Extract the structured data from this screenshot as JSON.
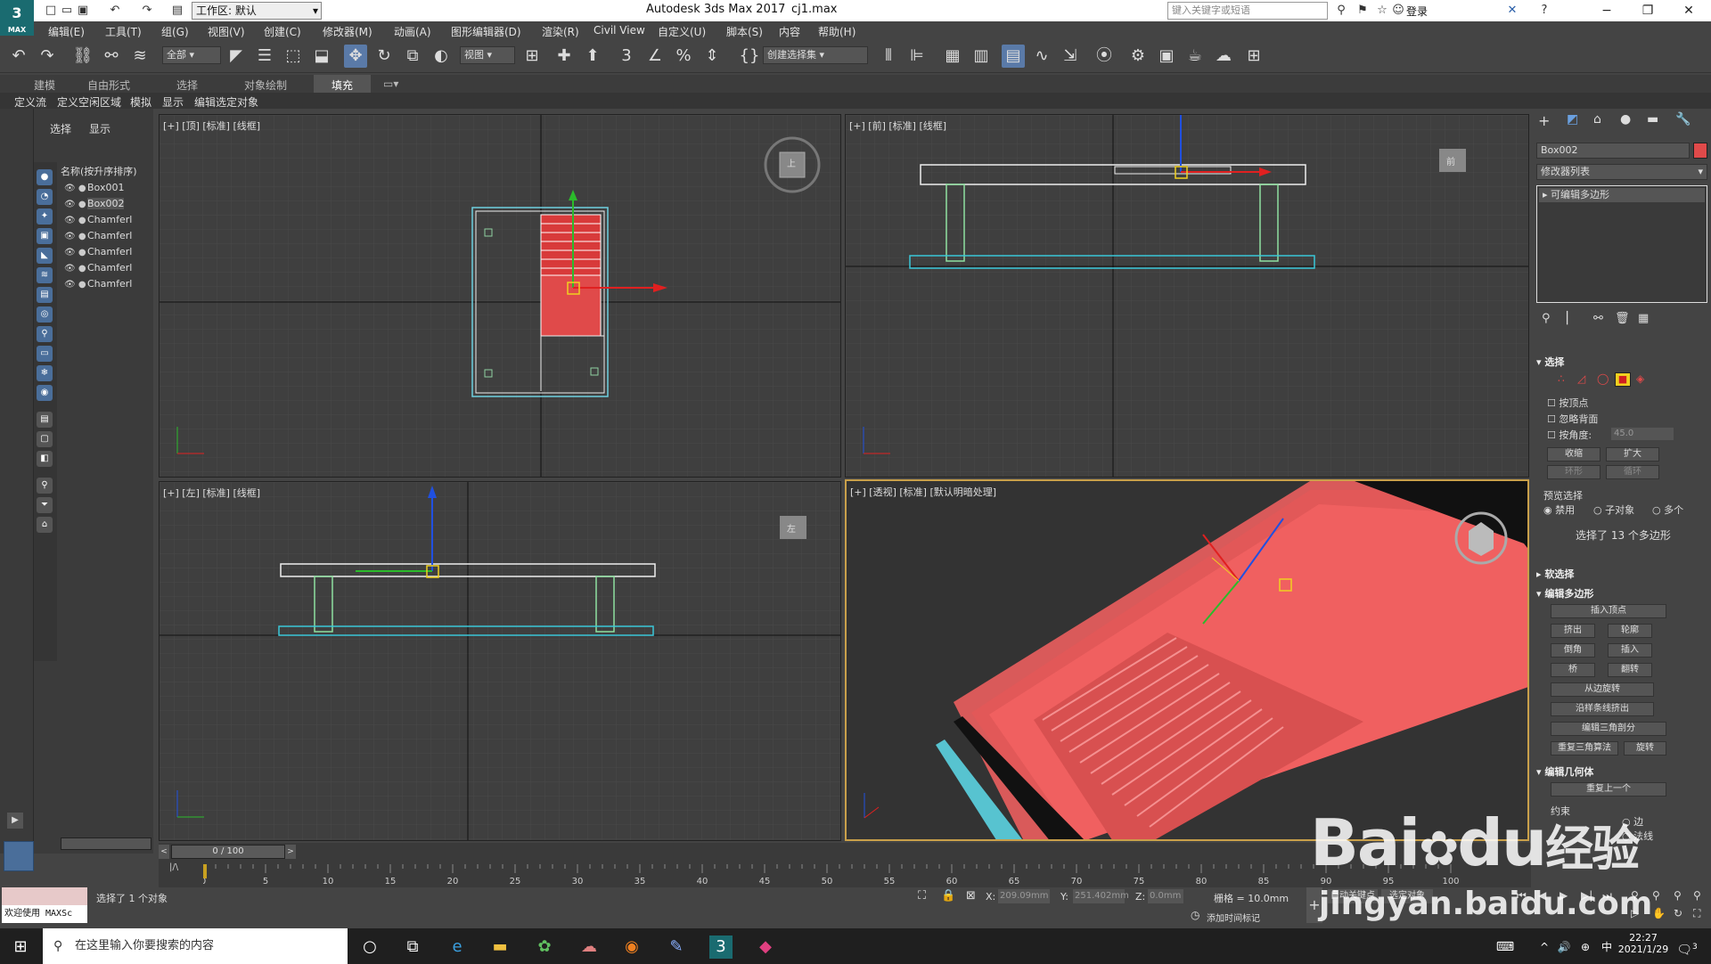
{
  "title": {
    "app_title": "Autodesk 3ds Max 2017",
    "file_name": "cj1.max",
    "logo": "3",
    "logo_sub": "MAX",
    "workspace": "工作区: 默认",
    "search_placeholder": "键入关键字或短语",
    "login": "登录"
  },
  "menu": [
    "编辑(E)",
    "工具(T)",
    "组(G)",
    "视图(V)",
    "创建(C)",
    "修改器(M)",
    "动画(A)",
    "图形编辑器(D)",
    "渲染(R)",
    "Civil View",
    "自定义(U)",
    "脚本(S)",
    "内容",
    "帮助(H)"
  ],
  "toolbar": {
    "filter": "全部",
    "refcoord": "视图",
    "selection_set": "创建选择集"
  },
  "ribbon_tabs": [
    "建模",
    "自由形式",
    "选择",
    "对象绘制",
    "填充"
  ],
  "ribbon_sub": [
    "定义流",
    "定义空闲区域",
    "模拟",
    "显示",
    "编辑选定对象"
  ],
  "explorer": {
    "tabs": [
      "选择",
      "显示"
    ],
    "header": "名称(按升序排序)",
    "items": [
      "Box001",
      "Box002",
      "Chamferl",
      "Chamferl",
      "Chamferl",
      "Chamferl",
      "Chamferl"
    ],
    "selected_index": 1
  },
  "viewports": {
    "top": "[+] [顶] [标准] [线框]",
    "front": "[+] [前] [标准] [线框]",
    "left": "[+] [左] [标准] [线框]",
    "persp": "[+] [透视] [标准] [默认明暗处理]",
    "cube_top": "上",
    "cube_front": "前",
    "cube_left": "左"
  },
  "command_panel": {
    "object_name": "Box002",
    "object_color": "#e04a4a",
    "modifier_list": "修改器列表",
    "stack_item": "可编辑多边形",
    "selection_title": "选择",
    "cb_vertex": "按顶点",
    "cb_backface": "忽略背面",
    "cb_angle": "按角度:",
    "angle_value": "45.0",
    "shrink": "收缩",
    "grow": "扩大",
    "ring": "环形",
    "loop": "循环",
    "preview": "预览选择",
    "disabled": "禁用",
    "subobj": "子对象",
    "multi": "多个",
    "selected_info": "选择了 13 个多边形",
    "soft_sel": "软选择",
    "edit_poly": "编辑多边形",
    "insert_vertex": "插入顶点",
    "extrude": "挤出",
    "outline": "轮廓",
    "bevel": "倒角",
    "inset": "插入",
    "bridge": "桥",
    "flip": "翻转",
    "hinge": "从边旋转",
    "extrude_spline": "沿样条线挤出",
    "edit_tri": "编辑三角剖分",
    "retriangulate": "重复三角算法",
    "turn": "旋转",
    "edit_geom": "编辑几何体",
    "repeat_last": "重复上一个",
    "constraints": "约束",
    "edge": "边",
    "normal": "法线"
  },
  "timeline": {
    "frame": "0 / 100",
    "ticks": [
      "0",
      "5",
      "10",
      "15",
      "20",
      "25",
      "30",
      "35",
      "40",
      "45",
      "50",
      "55",
      "60",
      "65",
      "70",
      "75",
      "80",
      "85",
      "90",
      "95",
      "100"
    ]
  },
  "status": {
    "maxscript": "欢迎使用 MAXSc",
    "selected": "选择了 1 个对象",
    "x_label": "X:",
    "x": "209.09mm",
    "y_label": "Y:",
    "y": "251.402mm",
    "z_label": "Z:",
    "z": "0.0mm",
    "grid": "栅格 = 10.0mm",
    "add_tag": "添加时间标记",
    "autokey": "自动关键点",
    "setkey": "选定对象"
  },
  "taskbar": {
    "search": "在这里输入你要搜索的内容",
    "time": "22:27",
    "date": "2021/1/29",
    "notif": "3"
  },
  "watermark": {
    "brand": "Bai",
    "brand2": "du",
    "cn": "经验",
    "url": "jingyan.baidu.com"
  }
}
